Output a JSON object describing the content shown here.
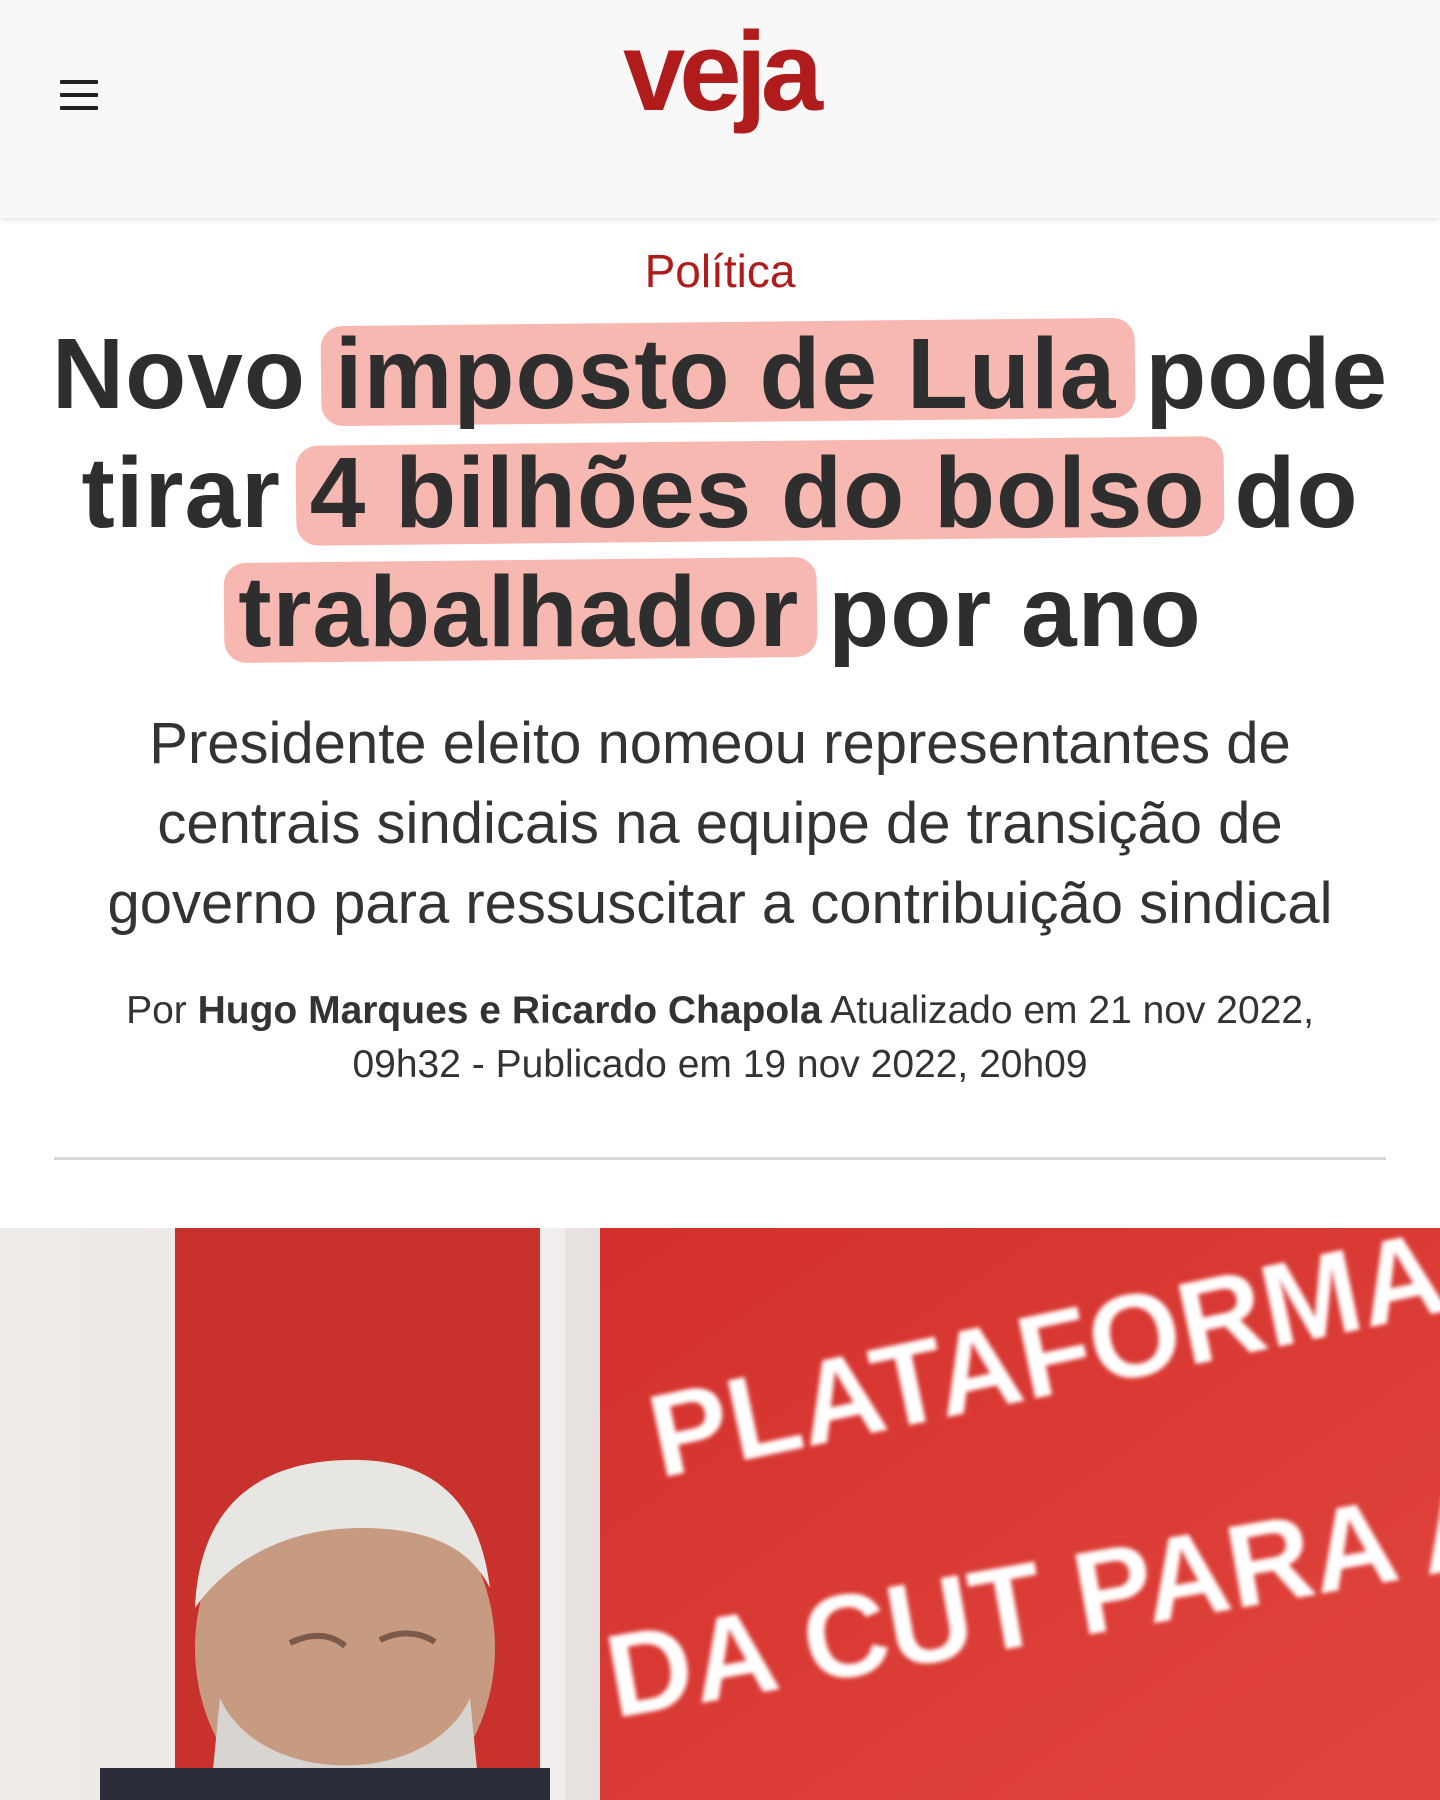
{
  "header": {
    "logo_text": "veja",
    "menu_icon": "hamburger-menu-icon"
  },
  "article": {
    "category": "Política",
    "headline": {
      "part1": "Novo ",
      "highlight1": "imposto de Lula",
      "part2": " pode tirar ",
      "highlight2": "4 bilhões do bolso",
      "part3": " do ",
      "highlight3": "trabalhador",
      "part4": " por ano"
    },
    "subtitle": "Presidente eleito nomeou representantes de centrais sindicais na equipe de transição de governo para ressuscitar a contribuição sindical",
    "byline": {
      "prefix": "Por ",
      "authors": "Hugo Marques e Ricardo Chapola",
      "dates": " Atualizado em 21 nov 2022, 09h32 - Publicado em 19 nov 2022, 20h09"
    },
    "photo": {
      "banner_line1": "PLATAFORMA",
      "banner_line2": "DA CUT PARA AS"
    }
  },
  "colors": {
    "brand": "#b01c1c",
    "highlight": "#f48c82",
    "text": "#2e2e2e",
    "banner_red": "#d8332f"
  }
}
